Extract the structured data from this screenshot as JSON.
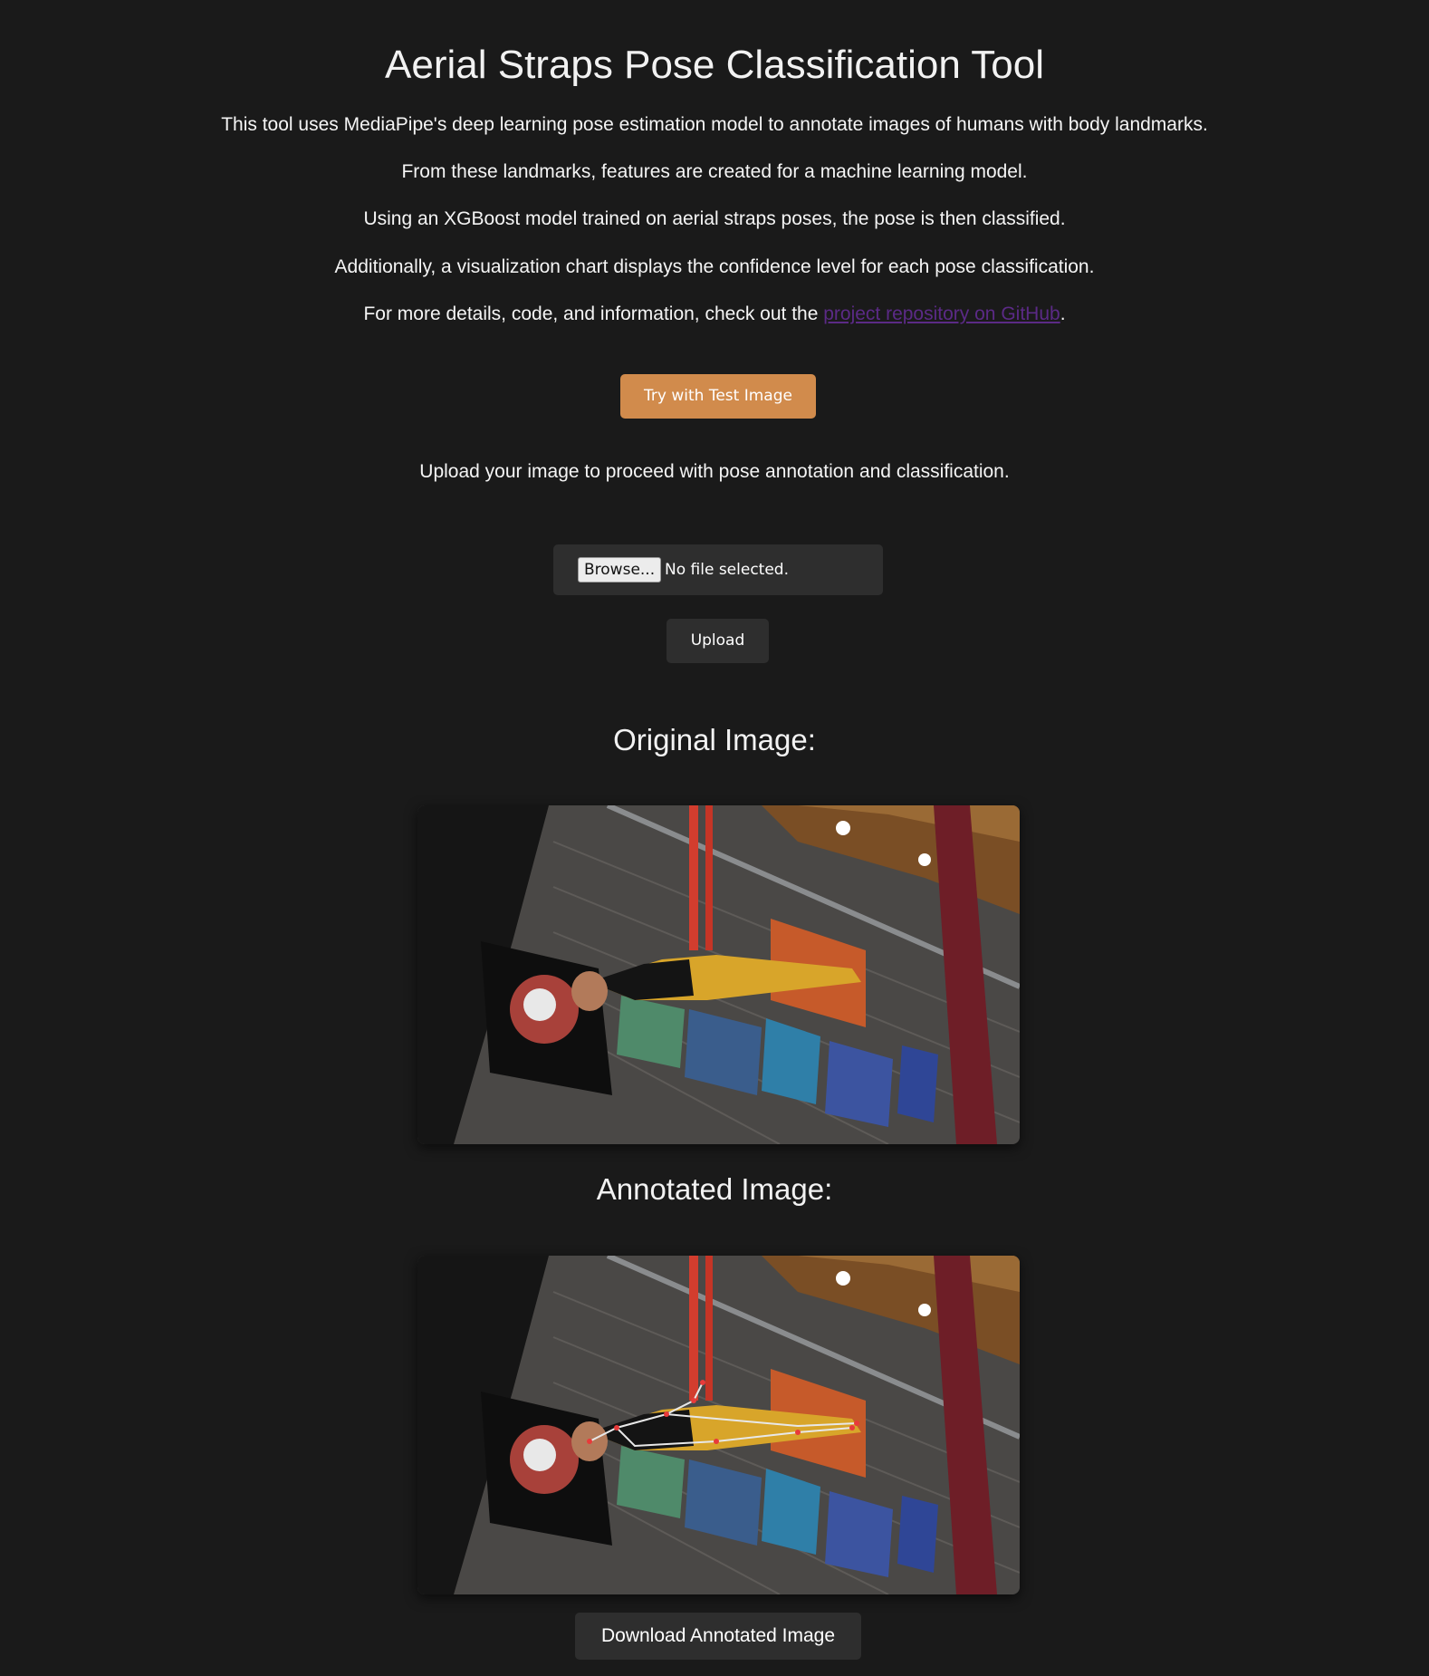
{
  "header": {
    "title": "Aerial Straps Pose Classification Tool"
  },
  "description": {
    "p1": "This tool uses MediaPipe's deep learning pose estimation model to annotate images of humans with body landmarks.",
    "p2": "From these landmarks, features are created for a machine learning model.",
    "p3": "Using an XGBoost model trained on aerial straps poses, the pose is then classified.",
    "p4": "Additionally, a visualization chart displays the confidence level for each pose classification.",
    "p5_prefix": "For more details, code, and information, check out the ",
    "p5_link": "project repository on GitHub",
    "p5_suffix": "."
  },
  "actions": {
    "test_image_label": "Try with Test Image",
    "upload_instructions": "Upload your image to proceed with pose annotation and classification.",
    "browse_label": "Browse...",
    "file_status": "No file selected.",
    "upload_label": "Upload"
  },
  "results": {
    "original_heading": "Original Image:",
    "annotated_heading": "Annotated Image:",
    "download_label": "Download Annotated Image"
  },
  "colors": {
    "background": "#1a1a1a",
    "accent_button": "#d18b4c",
    "dark_button": "#2e2e2e",
    "link": "#5b2a86"
  }
}
